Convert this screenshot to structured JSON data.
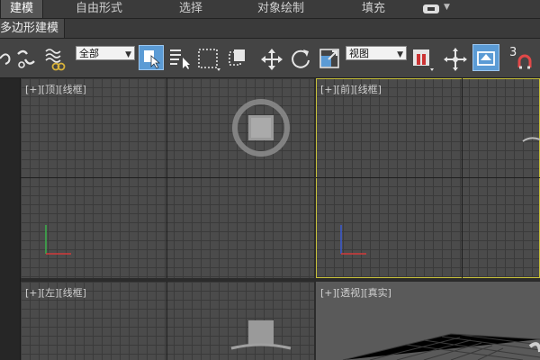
{
  "ribbon": {
    "tabs": [
      {
        "label": "建模",
        "active": true
      },
      {
        "label": "自由形式",
        "active": false
      },
      {
        "label": "选择",
        "active": false
      },
      {
        "label": "对象绘制",
        "active": false
      },
      {
        "label": "填充",
        "active": false
      }
    ],
    "extra_icon": "display-dropdown-icon"
  },
  "subtab": {
    "label": "多边形建模"
  },
  "toolbar": {
    "selection_filter": "全部",
    "reference_coord": "视图",
    "snap_number": "3"
  },
  "viewports": [
    {
      "label": "[+][顶][线框]",
      "view": "top"
    },
    {
      "label": "[+][前][线框]",
      "view": "front",
      "active": true
    },
    {
      "label": "[+][左][线框]",
      "view": "left"
    },
    {
      "label": "[+][透视][真实]",
      "view": "perspective"
    }
  ],
  "colors": {
    "active_border": "#c9c23a",
    "highlight": "#5b9bd5"
  }
}
